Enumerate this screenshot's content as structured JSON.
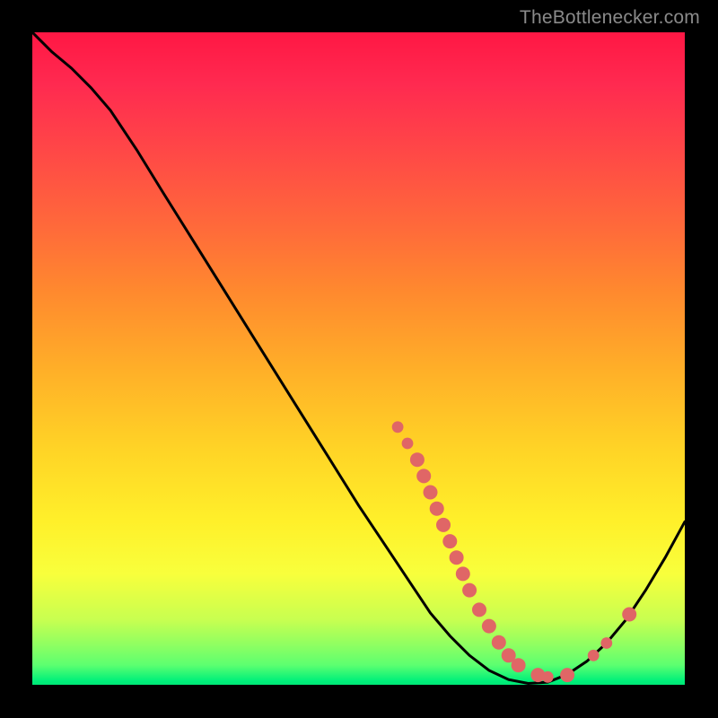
{
  "watermark": "TheBottlenecker.com",
  "colors": {
    "curve": "#000000",
    "dot_fill": "#e06666",
    "dot_stroke": "#c94f4f"
  },
  "chart_data": {
    "type": "line",
    "title": "",
    "xlabel": "",
    "ylabel": "",
    "xlim": [
      0,
      100
    ],
    "ylim": [
      0,
      100
    ],
    "curve": [
      {
        "x": 0.0,
        "y": 100.0
      },
      {
        "x": 3.0,
        "y": 97.0
      },
      {
        "x": 6.0,
        "y": 94.5
      },
      {
        "x": 9.0,
        "y": 91.5
      },
      {
        "x": 12.0,
        "y": 88.0
      },
      {
        "x": 16.0,
        "y": 82.0
      },
      {
        "x": 20.0,
        "y": 75.5
      },
      {
        "x": 25.0,
        "y": 67.5
      },
      {
        "x": 30.0,
        "y": 59.5
      },
      {
        "x": 35.0,
        "y": 51.5
      },
      {
        "x": 40.0,
        "y": 43.5
      },
      {
        "x": 45.0,
        "y": 35.5
      },
      {
        "x": 50.0,
        "y": 27.5
      },
      {
        "x": 55.0,
        "y": 20.0
      },
      {
        "x": 58.0,
        "y": 15.5
      },
      {
        "x": 61.0,
        "y": 11.0
      },
      {
        "x": 64.0,
        "y": 7.5
      },
      {
        "x": 67.0,
        "y": 4.5
      },
      {
        "x": 70.0,
        "y": 2.2
      },
      {
        "x": 73.0,
        "y": 0.8
      },
      {
        "x": 76.0,
        "y": 0.2
      },
      {
        "x": 79.0,
        "y": 0.4
      },
      {
        "x": 82.0,
        "y": 1.6
      },
      {
        "x": 85.0,
        "y": 3.6
      },
      {
        "x": 88.0,
        "y": 6.4
      },
      {
        "x": 91.0,
        "y": 10.0
      },
      {
        "x": 94.0,
        "y": 14.5
      },
      {
        "x": 97.0,
        "y": 19.5
      },
      {
        "x": 100.0,
        "y": 25.0
      }
    ],
    "dots": [
      {
        "x": 56.0,
        "y": 39.5,
        "r": 4
      },
      {
        "x": 57.5,
        "y": 37.0,
        "r": 4
      },
      {
        "x": 59.0,
        "y": 34.5,
        "r": 5
      },
      {
        "x": 60.0,
        "y": 32.0,
        "r": 5
      },
      {
        "x": 61.0,
        "y": 29.5,
        "r": 5
      },
      {
        "x": 62.0,
        "y": 27.0,
        "r": 5
      },
      {
        "x": 63.0,
        "y": 24.5,
        "r": 5
      },
      {
        "x": 64.0,
        "y": 22.0,
        "r": 5
      },
      {
        "x": 65.0,
        "y": 19.5,
        "r": 5
      },
      {
        "x": 66.0,
        "y": 17.0,
        "r": 5
      },
      {
        "x": 67.0,
        "y": 14.5,
        "r": 5
      },
      {
        "x": 68.5,
        "y": 11.5,
        "r": 5
      },
      {
        "x": 70.0,
        "y": 9.0,
        "r": 5
      },
      {
        "x": 71.5,
        "y": 6.5,
        "r": 5
      },
      {
        "x": 73.0,
        "y": 4.5,
        "r": 5
      },
      {
        "x": 74.5,
        "y": 3.0,
        "r": 5
      },
      {
        "x": 77.5,
        "y": 1.5,
        "r": 5
      },
      {
        "x": 79.0,
        "y": 1.2,
        "r": 4
      },
      {
        "x": 82.0,
        "y": 1.5,
        "r": 5
      },
      {
        "x": 86.0,
        "y": 4.5,
        "r": 4
      },
      {
        "x": 88.0,
        "y": 6.4,
        "r": 4
      },
      {
        "x": 91.5,
        "y": 10.8,
        "r": 5
      }
    ]
  }
}
